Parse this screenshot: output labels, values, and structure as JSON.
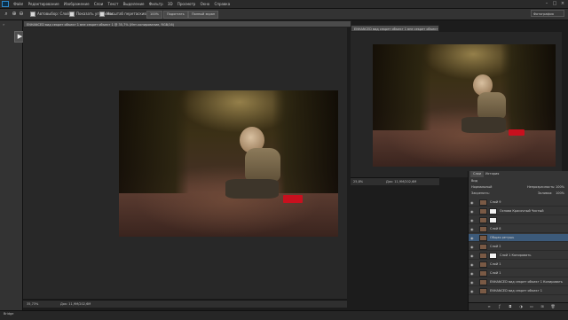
{
  "menubar": {
    "items": [
      "Файл",
      "Редактирование",
      "Изображение",
      "Слои",
      "Текст",
      "Выделение",
      "Фильтр",
      "3D",
      "Просмотр",
      "Окно",
      "Справка"
    ]
  },
  "options": {
    "auto_select": "Автовыбор: Слой",
    "show_transform": "Показать упр. элем.",
    "scrub_zoom": "Масштаб перетаскиванием",
    "zoom_100": "100%",
    "fit_screen": "Подогнать",
    "fill_screen": "Полный экран",
    "workspace": "Фотография"
  },
  "doc1": {
    "tab": "ENHANCED вид секрет объект 1 вне секрет объект 1 @ 35,7% (Инт.копирование, RGB/16)",
    "zoom": "35,73%",
    "info": "Док: 11,9M/202,6M"
  },
  "doc2": {
    "tab": "ENHANCED вид секрет объект 1 вне секрет объект 1-ext @ 25,8% (Копия вне, RGB/16)",
    "zoom": "25,8%",
    "info": "Док: 11,9M/202,6M"
  },
  "layers_panel": {
    "tabs": [
      "Слои",
      "История"
    ],
    "kind": "Вид",
    "blend_mode": "Нормальный",
    "opacity_label": "Непрозрачность:",
    "opacity": "100%",
    "fill_label": "Заливка:",
    "fill": "100%",
    "lock_label": "Закрепить:",
    "layers": [
      {
        "name": "Слой 9",
        "mask": false,
        "selected": false
      },
      {
        "name": "Основа Красочный Чистый",
        "mask": true,
        "selected": false
      },
      {
        "name": "",
        "mask": true,
        "selected": false
      },
      {
        "name": "Слой 8",
        "mask": false,
        "selected": false
      },
      {
        "name": "Общая ретушь",
        "mask": false,
        "selected": true
      },
      {
        "name": "Слой 2",
        "mask": false,
        "selected": false
      },
      {
        "name": "Слой 1 Копировать",
        "mask": true,
        "selected": false
      },
      {
        "name": "Слой 1",
        "mask": false,
        "selected": false
      },
      {
        "name": "Слой 1",
        "mask": false,
        "selected": false
      },
      {
        "name": "ENHANCED вид секрет объект 1 Копировать",
        "mask": false,
        "selected": false
      },
      {
        "name": "ENHANCED вид секрет объект 1",
        "mask": false,
        "selected": false
      }
    ]
  },
  "bottom_bar": {
    "label": "Bridge"
  }
}
